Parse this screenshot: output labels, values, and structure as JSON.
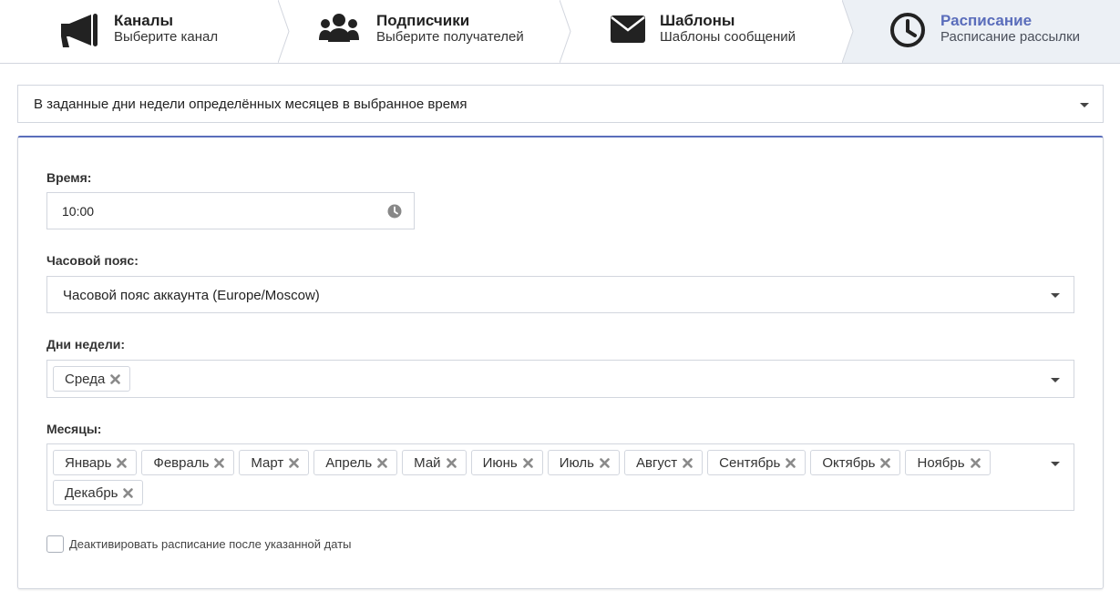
{
  "steps": [
    {
      "title": "Каналы",
      "subtitle": "Выберите канал",
      "icon": "megaphone-icon"
    },
    {
      "title": "Подписчики",
      "subtitle": "Выберите получателей",
      "icon": "users-icon"
    },
    {
      "title": "Шаблоны",
      "subtitle": "Шаблоны сообщений",
      "icon": "envelope-icon"
    },
    {
      "title": "Расписание",
      "subtitle": "Расписание рассылки",
      "icon": "clock-icon",
      "active": true
    }
  ],
  "schedule_type": "В заданные дни недели определённых месяцев в выбранное время",
  "form": {
    "time_label": "Время:",
    "time_value": "10:00",
    "timezone_label": "Часовой пояс:",
    "timezone_value": "Часовой пояс аккаунта (Europe/Moscow)",
    "weekdays_label": "Дни недели:",
    "weekdays": [
      "Среда"
    ],
    "months_label": "Месяцы:",
    "months": [
      "Январь",
      "Февраль",
      "Март",
      "Апрель",
      "Май",
      "Июнь",
      "Июль",
      "Август",
      "Сентябрь",
      "Октябрь",
      "Ноябрь",
      "Декабрь"
    ],
    "deactivate_label": "Деактивировать расписание после указанной даты",
    "deactivate_checked": false
  },
  "colors": {
    "accent": "#5a6dbb",
    "active_step_bg": "#ecf0f5",
    "border": "#d2d6de"
  }
}
